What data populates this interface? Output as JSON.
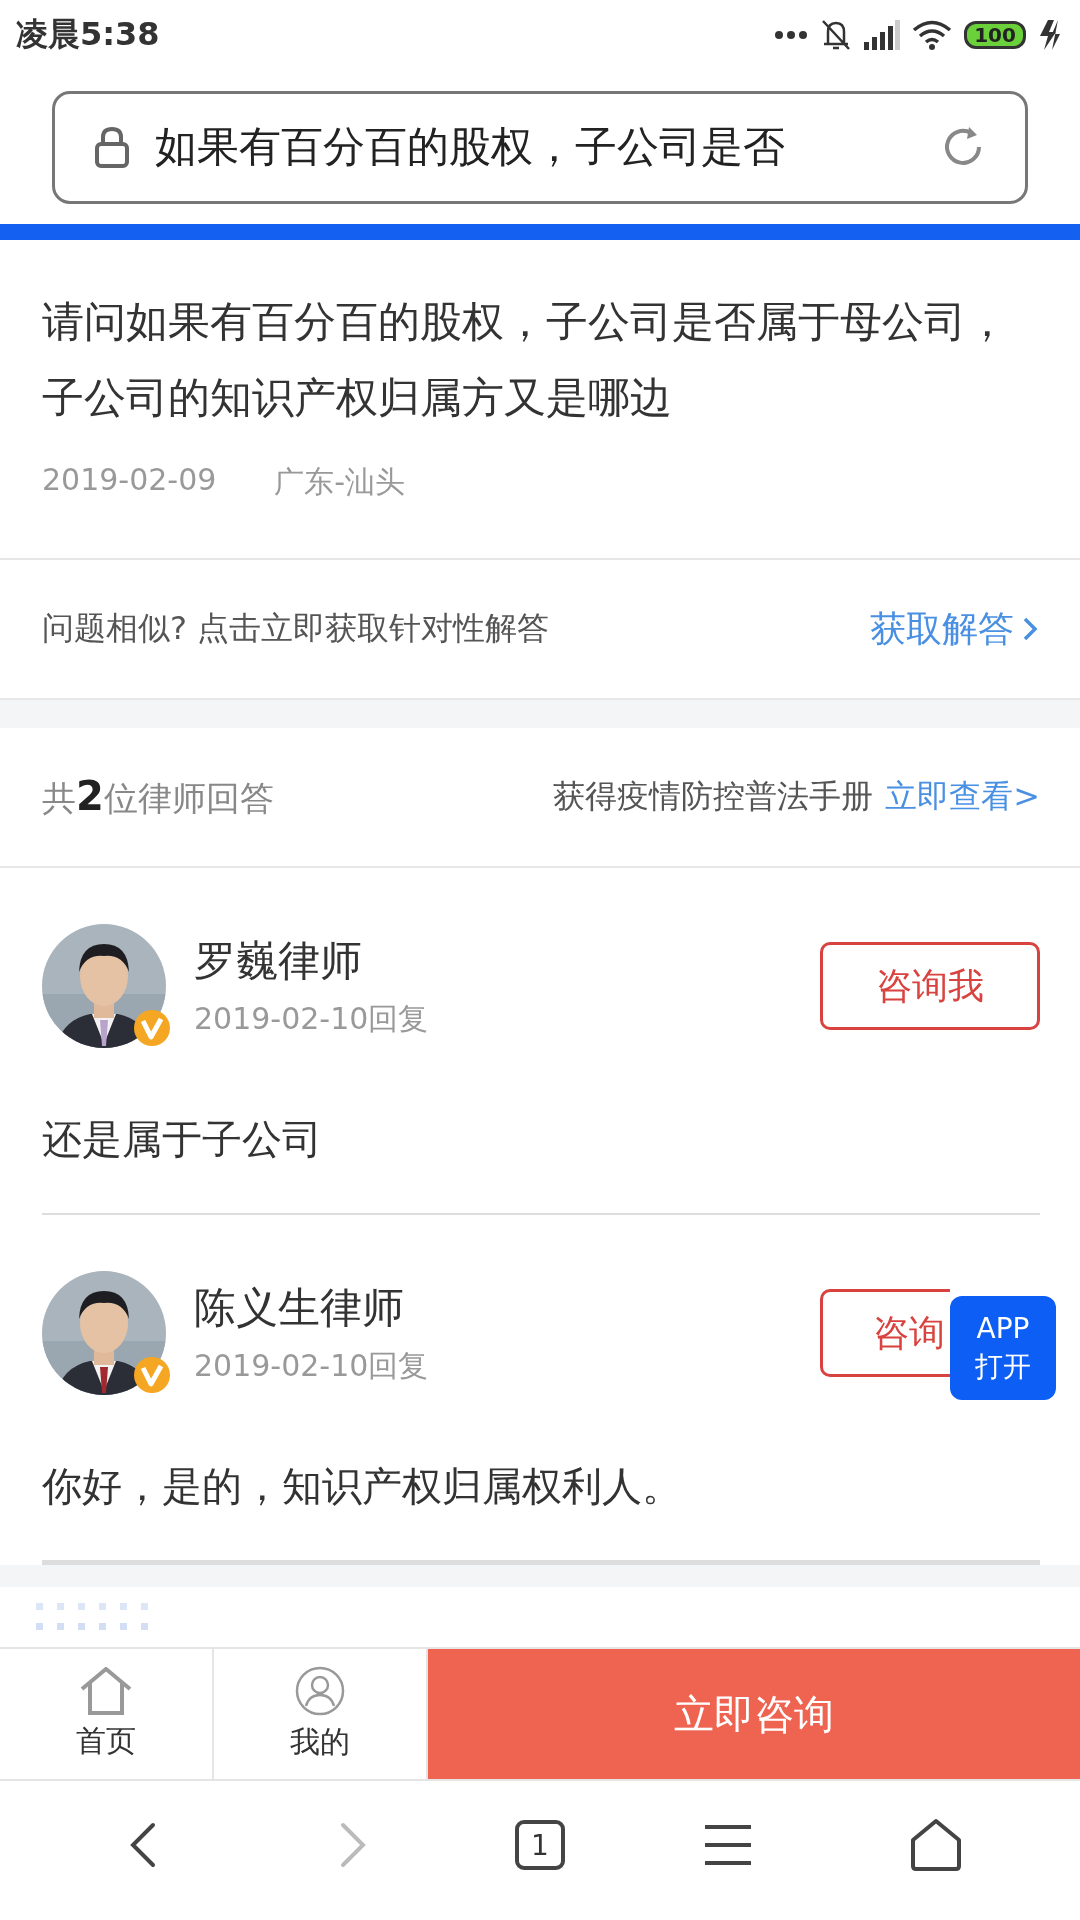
{
  "status_bar": {
    "time": "凌晨5:38",
    "battery": "100"
  },
  "address_bar": {
    "url_text": "如果有百分百的股权，子公司是否",
    "secure": true
  },
  "question": {
    "text": "请问如果有百分百的股权，子公司是否属于母公司，子公司的知识产权归属方又是哪边",
    "date": "2019-02-09",
    "location": "广东-汕头"
  },
  "similar_prompt": {
    "text": "问题相似? 点击立即获取针对性解答",
    "link": "获取解答"
  },
  "answers_header": {
    "count_text": "共**2**位律师回答",
    "promo": "获得疫情防控普法手册",
    "promo_link": "立即查看>"
  },
  "answers": [
    {
      "lawyer": "罗巍律师",
      "date": "2019-02-10回复",
      "button": "咨询我",
      "verified": true,
      "text": "还是属于子公司"
    },
    {
      "lawyer": "陈义生律师",
      "date": "2019-02-10回复",
      "button": "咨询",
      "verified": true,
      "text": "你好，是的，知识产权归属权利人。"
    }
  ],
  "app_badge": [
    "APP",
    "打开"
  ],
  "bottom_nav": [
    {
      "kind": "home",
      "label": "首页"
    },
    {
      "kind": "profile",
      "label": "我的"
    }
  ],
  "consult_button": "立即咨询",
  "browser_toolbar": [
    {
      "kind": "back",
      "disabled": false
    },
    {
      "kind": "forward",
      "disabled": true
    },
    {
      "kind": "tabs",
      "count": "1"
    },
    {
      "kind": "menu"
    },
    {
      "kind": "home"
    }
  ]
}
